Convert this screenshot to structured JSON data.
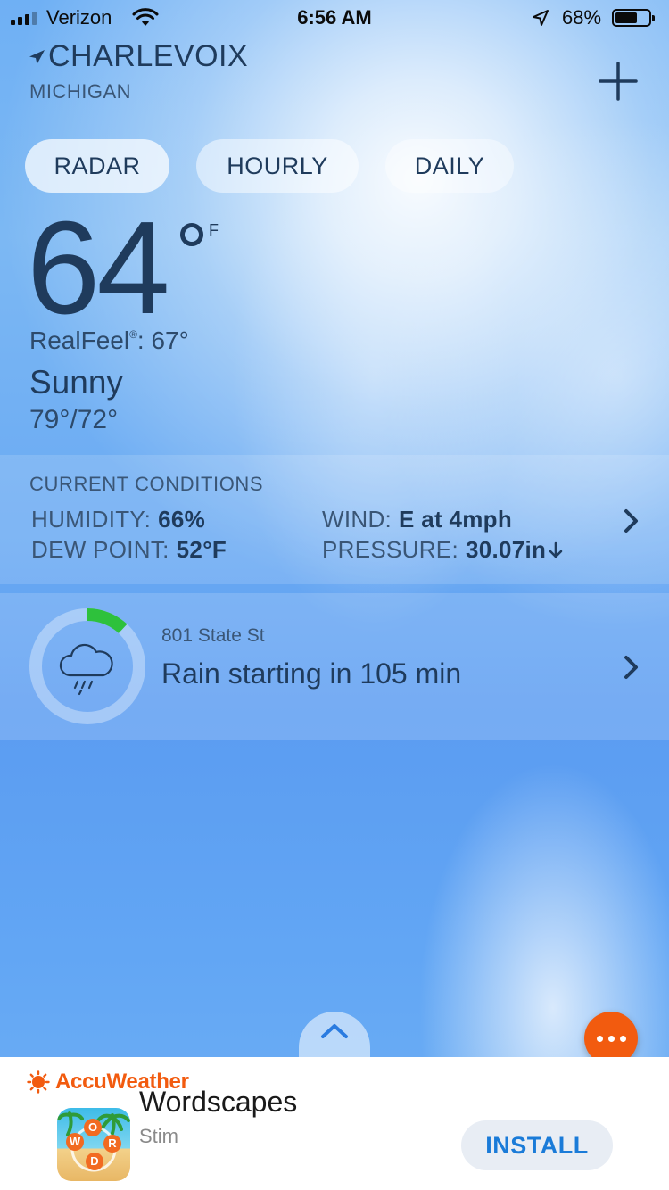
{
  "status_bar": {
    "carrier": "Verizon",
    "time": "6:56 AM",
    "battery": "68%",
    "battery_level": 0.68,
    "signal_bars": 3,
    "signal_total": 4
  },
  "location": {
    "city": "CHARLEVOIX",
    "state": "MICHIGAN",
    "add_icon": "plus-icon"
  },
  "tabs": [
    {
      "label": "RADAR"
    },
    {
      "label": "HOURLY"
    },
    {
      "label": "DAILY"
    }
  ],
  "current": {
    "temperature": "64",
    "unit": "F",
    "realfeel_label": "RealFeel",
    "realfeel_mark": "®",
    "realfeel_value": ": 67°",
    "condition": "Sunny",
    "hi_lo": "79°/72°"
  },
  "conditions": {
    "title": "CURRENT CONDITIONS",
    "humidity_label": "HUMIDITY:",
    "humidity_value": "66%",
    "dew_point_label": "DEW POINT:",
    "dew_point_value": "52°F",
    "wind_label": "WIND:",
    "wind_value": "E at 4mph",
    "pressure_label": "PRESSURE:",
    "pressure_value": "30.07in",
    "pressure_trend_icon": "arrow-down-icon"
  },
  "minutecast": {
    "address": "801 State St",
    "message": "Rain starting in 105 min",
    "progress": 0.12,
    "icon": "rain-cloud-icon"
  },
  "ad": {
    "brand": "AccuWeather",
    "app_name": "Wordscapes",
    "developer": "Stim",
    "install_label": "INSTALL",
    "icon_letters": [
      "W",
      "O",
      "R",
      "D"
    ]
  },
  "colors": {
    "accent_orange": "#f25b0f",
    "text_navy": "#1f3b5c",
    "ring_green": "#2ec13c",
    "install_blue": "#1a7bd8"
  }
}
